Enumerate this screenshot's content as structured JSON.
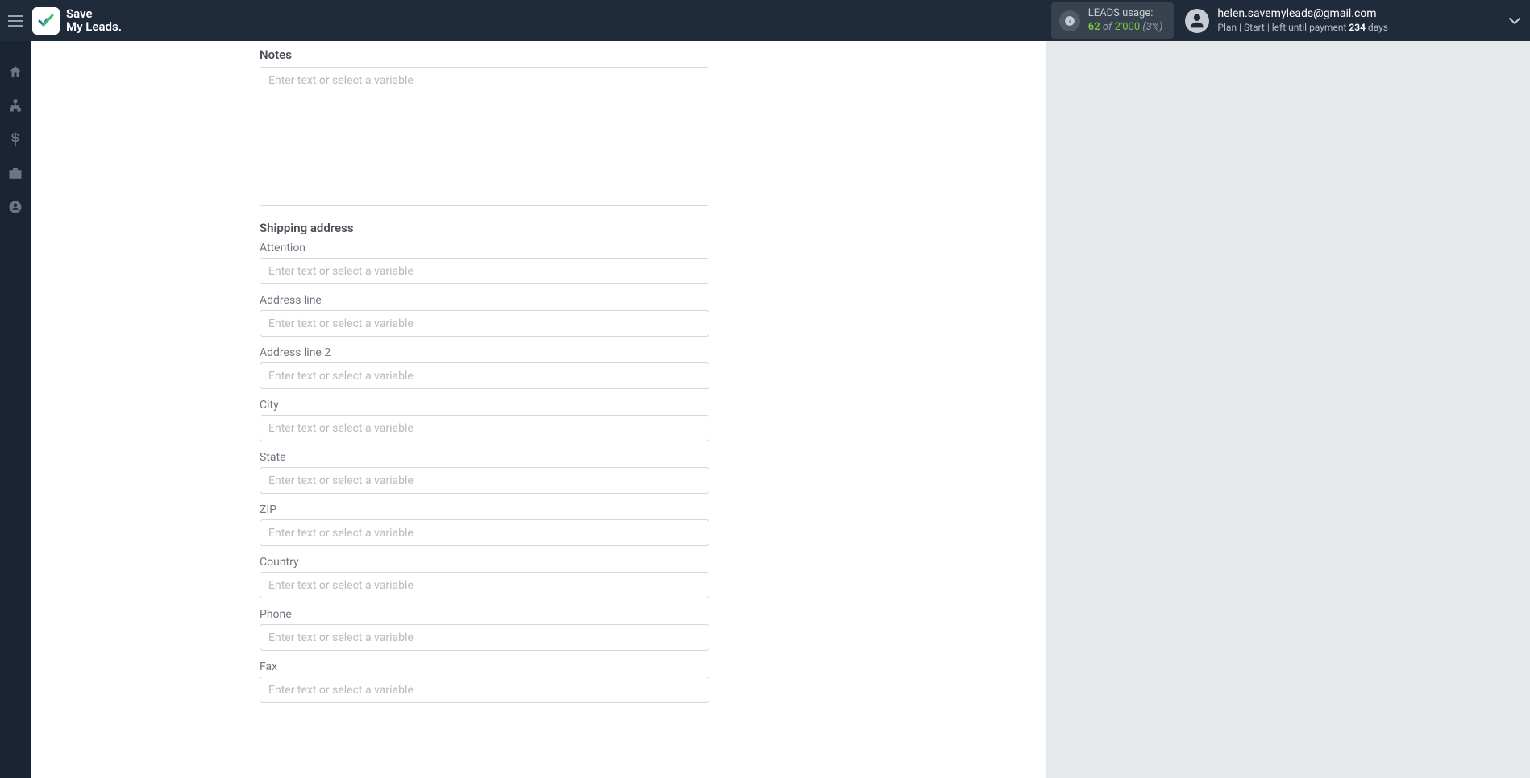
{
  "brand": {
    "line1": "Save",
    "line2": "My Leads."
  },
  "usage": {
    "label": "LEADS usage:",
    "used": "62",
    "of": "of",
    "limit": "2'000",
    "pct": "(3%)"
  },
  "user": {
    "email": "helen.savemyleads@gmail.com",
    "plan_prefix": "Plan |",
    "plan_name": "Start",
    "plan_mid": "| left until payment",
    "days_num": "234",
    "days_suffix": "days"
  },
  "form": {
    "notes_label": "Notes",
    "placeholder": "Enter text or select a variable",
    "section_shipping": "Shipping address",
    "fields": {
      "attention": "Attention",
      "address_line": "Address line",
      "address_line2": "Address line 2",
      "city": "City",
      "state": "State",
      "zip": "ZIP",
      "country": "Country",
      "phone": "Phone",
      "fax": "Fax"
    }
  }
}
